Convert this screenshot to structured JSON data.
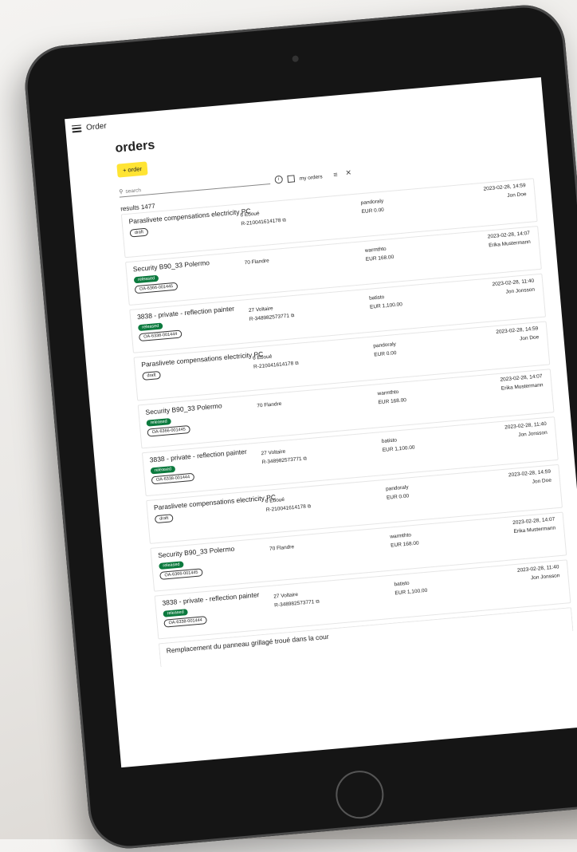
{
  "app": {
    "title": "Order",
    "menu_icon": "hamburger-menu-icon"
  },
  "page": {
    "title": "orders"
  },
  "new_order": {
    "label": "+ order"
  },
  "toolbar": {
    "search_placeholder": "search",
    "search_icon": "search-icon",
    "info_icon": "info-icon",
    "my_orders_label": "my orders",
    "filter_icon": "filter-icon",
    "clear_icon": "close-icon"
  },
  "results": {
    "text": "results 1477"
  },
  "colors": {
    "accent_button": "#ffe433",
    "released_badge": "#0c7a3e"
  },
  "orders": [
    {
      "title": "Paraslivete compensations electricity PC",
      "status": "draft",
      "id": "",
      "address": "6 Eboué",
      "reference": "R-210041614178",
      "supplier": "pandoraly",
      "amount": "EUR 0.00",
      "date": "2023-02-28, 14:59",
      "user": "Jon Doe"
    },
    {
      "title": "Security B90_33 Polermo",
      "status": "released",
      "id": "OA-6366-001445",
      "address": "70 Flandre",
      "reference": "",
      "supplier": "warmthto",
      "amount": "EUR 168.00",
      "date": "2023-02-28, 14:07",
      "user": "Erika Mustermann"
    },
    {
      "title": "3838 - private - reflection painter",
      "status": "released",
      "id": "OA-6338-001444",
      "address": "27 Voltaire",
      "reference": "R-348982573771",
      "supplier": "batisto",
      "amount": "EUR 1,100.00",
      "date": "2023-02-28, 11:40",
      "user": "Jon Jonsson"
    },
    {
      "title": "Paraslivete compensations electricity PC",
      "status": "draft",
      "id": "",
      "address": "6 Eboué",
      "reference": "R-210041614178",
      "supplier": "pandoraly",
      "amount": "EUR 0.00",
      "date": "2023-02-28, 14:59",
      "user": "Jon Doe"
    },
    {
      "title": "Security B90_33 Polermo",
      "status": "released",
      "id": "OA-6366-001445",
      "address": "70 Flandre",
      "reference": "",
      "supplier": "warmthto",
      "amount": "EUR 168.00",
      "date": "2023-02-28, 14:07",
      "user": "Erika Mustermann"
    },
    {
      "title": "3838 - private - reflection painter",
      "status": "released",
      "id": "OA-6338-001444",
      "address": "27 Voltaire",
      "reference": "R-348982573771",
      "supplier": "batisto",
      "amount": "EUR 1,100.00",
      "date": "2023-02-28, 11:40",
      "user": "Jon Jonsson"
    },
    {
      "title": "Paraslivete compensations electricity PC",
      "status": "draft",
      "id": "",
      "address": "6 Eboué",
      "reference": "R-210041614178",
      "supplier": "pandoraly",
      "amount": "EUR 0.00",
      "date": "2023-02-28, 14:59",
      "user": "Jon Doe"
    },
    {
      "title": "Security B90_33 Polermo",
      "status": "released",
      "id": "OA-6366-001445",
      "address": "70 Flandre",
      "reference": "",
      "supplier": "warmthto",
      "amount": "EUR 168.00",
      "date": "2023-02-28, 14:07",
      "user": "Erika Mustermann"
    },
    {
      "title": "3838 - private - reflection painter",
      "status": "released",
      "id": "OA-6338-001444",
      "address": "27 Voltaire",
      "reference": "R-348982573771",
      "supplier": "batisto",
      "amount": "EUR 1,100.00",
      "date": "2023-02-28, 11:40",
      "user": "Jon Jonsson"
    },
    {
      "title": "Remplacement du panneau grillagé troué dans la cour",
      "status": "",
      "id": "",
      "address": "",
      "reference": "",
      "supplier": "",
      "amount": "",
      "date": "",
      "user": ""
    }
  ]
}
